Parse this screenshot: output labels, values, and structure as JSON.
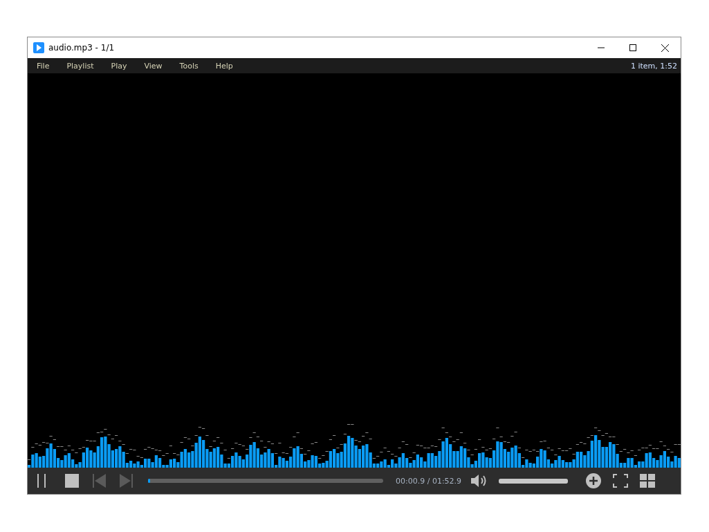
{
  "window": {
    "title": "audio.mp3 - 1/1"
  },
  "menu": [
    "File",
    "Playlist",
    "Play",
    "View",
    "Tools",
    "Help"
  ],
  "status": "1 item, 1:52",
  "controls": {
    "seek": {
      "level": 0.008
    },
    "time": "00:00.9 / 01:52.9",
    "volume": {
      "level": 1
    }
  }
}
